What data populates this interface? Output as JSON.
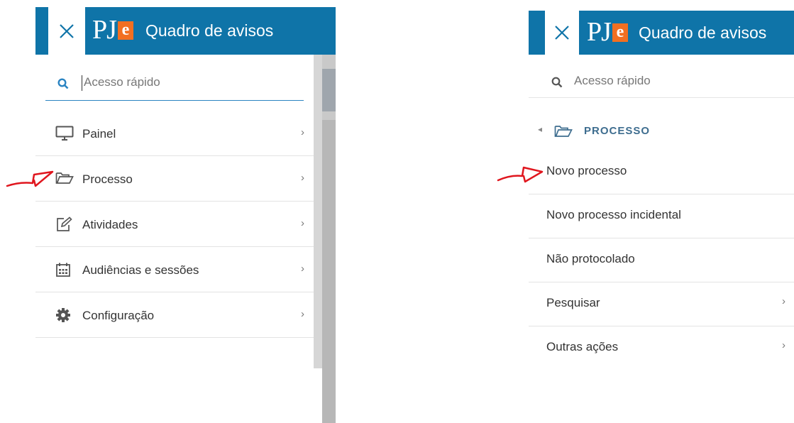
{
  "left_panel": {
    "header": {
      "title": "Quadro de avisos",
      "logo_text": "PJ",
      "logo_e": "e"
    },
    "search": {
      "placeholder": "Acesso rápido"
    },
    "menu": [
      {
        "label": "Painel",
        "icon": "monitor-icon"
      },
      {
        "label": "Processo",
        "icon": "folder-open-icon"
      },
      {
        "label": "Atividades",
        "icon": "edit-icon"
      },
      {
        "label": "Audiências e sessões",
        "icon": "calendar-icon"
      },
      {
        "label": "Configuração",
        "icon": "gear-icon"
      }
    ]
  },
  "right_panel": {
    "header": {
      "title": "Quadro de avisos",
      "logo_text": "PJ",
      "logo_e": "e"
    },
    "search": {
      "placeholder": "Acesso rápido"
    },
    "submenu_title": "PROCESSO",
    "items": [
      {
        "label": "Novo processo"
      },
      {
        "label": "Novo processo incidental"
      },
      {
        "label": "Não protocolado"
      },
      {
        "label": "Pesquisar",
        "has_children": true
      },
      {
        "label": "Outras ações",
        "has_children": true
      }
    ]
  },
  "colors": {
    "header_blue": "#0f74a8",
    "accent_orange": "#f26f21",
    "annotation_red": "#e0161e"
  }
}
